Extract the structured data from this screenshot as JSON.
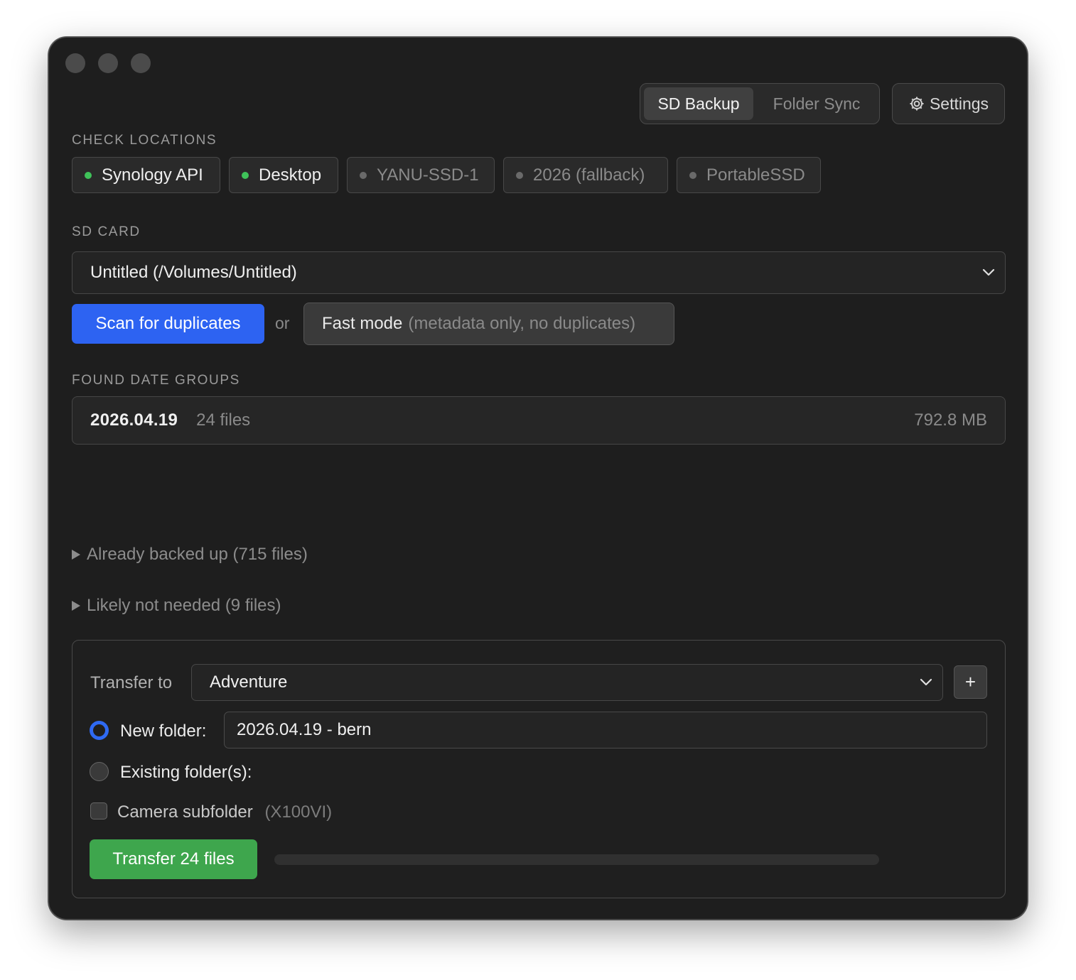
{
  "mode_tabs": [
    {
      "label": "SD Backup",
      "active": true
    },
    {
      "label": "Folder Sync",
      "active": false
    }
  ],
  "settings": {
    "label": "Settings",
    "icon": "gear-icon"
  },
  "check_locations": {
    "heading": "CHECK LOCATIONS",
    "items": [
      {
        "label": "Synology API",
        "status": "online"
      },
      {
        "label": "Desktop",
        "status": "online"
      },
      {
        "label": "YANU-SSD-1",
        "status": "offline"
      },
      {
        "label": "2026 (fallback)",
        "status": "offline"
      },
      {
        "label": "PortableSSD",
        "status": "offline"
      }
    ]
  },
  "sd_card": {
    "heading": "SD CARD",
    "selected": "Untitled (/Volumes/Untitled)"
  },
  "actions": {
    "scan_label": "Scan for duplicates",
    "or_label": "or",
    "fast_mode_label": "Fast mode",
    "fast_mode_note": "(metadata only, no duplicates)"
  },
  "found_groups": {
    "heading": "FOUND DATE GROUPS",
    "rows": [
      {
        "date": "2026.04.19",
        "files": "24 files",
        "size": "792.8 MB"
      }
    ]
  },
  "disclosures": {
    "already_backed_up": "Already backed up (715 files)",
    "likely_not_needed": "Likely not needed (9 files)"
  },
  "transfer": {
    "transfer_to_label": "Transfer to",
    "destination": "Adventure",
    "add_label": "+",
    "new_folder_label": "New folder:",
    "new_folder_value": "2026.04.19 - bern",
    "existing_folder_label": "Existing folder(s):",
    "selected_option": "new_folder",
    "camera_subfolder_label": "Camera subfolder",
    "camera_subfolder_model": "(X100VI)",
    "camera_subfolder_checked": false,
    "button_label": "Transfer 24 files",
    "progress": 0
  },
  "colors": {
    "accent_blue": "#2d63f2",
    "success_green": "#3ea64d",
    "online_dot": "#3fc259",
    "offline_dot": "#6a6a6a"
  }
}
